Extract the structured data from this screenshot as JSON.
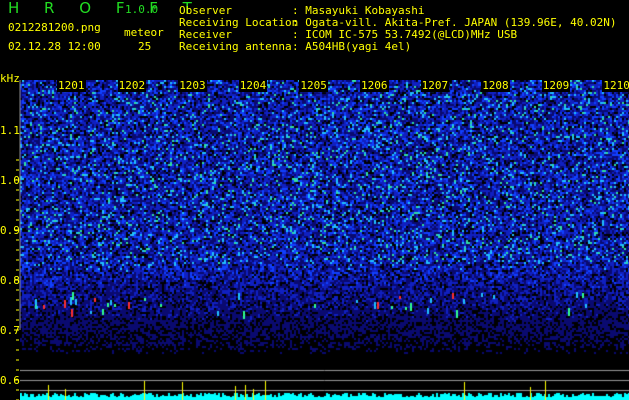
{
  "app": {
    "name": "H R O F F T",
    "version": "1.0.0"
  },
  "file": {
    "name": "0212281200.png",
    "datetime": "02.12.28 12:00"
  },
  "meteor": {
    "label": "meteor",
    "count": "25"
  },
  "info": [
    {
      "key": "Observer",
      "value": "Masayuki Kobayashi"
    },
    {
      "key": "Receiving Location",
      "value": "Ogata-vill. Akita-Pref. JAPAN (139.96E, 40.02N)"
    },
    {
      "key": "Receiver",
      "value": "ICOM IC-575 53.7492(@LCD)MHz USB"
    },
    {
      "key": "Receiving antenna",
      "value": "A504HB(yagi 4el)"
    }
  ],
  "axis": {
    "unit": "kHz",
    "freq_labels": [
      "1.1",
      "1.0",
      "0.9",
      "0.8",
      "0.7",
      "0.6"
    ],
    "time_labels": [
      "1201",
      "1202",
      "1203",
      "1204",
      "1205",
      "1206",
      "1207",
      "1208",
      "1209",
      "1210"
    ]
  },
  "colors": {
    "text": "#ffff00",
    "title": "#22dd22",
    "histogram": "#00ffff",
    "background": "#000000"
  }
}
